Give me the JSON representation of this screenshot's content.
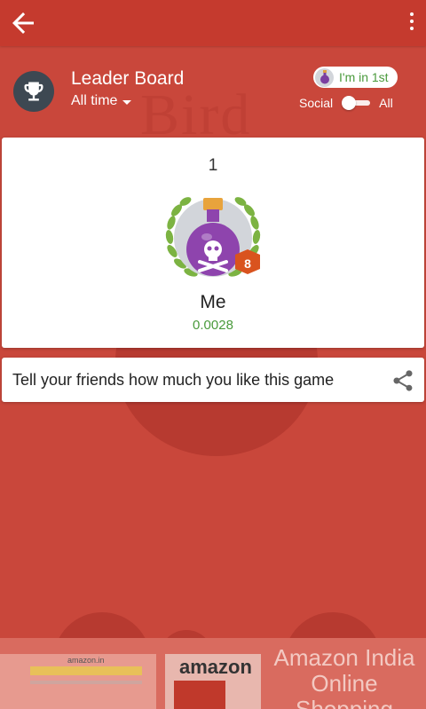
{
  "header": {
    "title": "Leader Board",
    "time_filter": "All time",
    "rank_chip": "I'm in 1st",
    "toggle_left": "Social",
    "toggle_right": "All"
  },
  "player": {
    "rank": "1",
    "badge_level": "8",
    "name": "Me",
    "score": "0.0028"
  },
  "share": {
    "text": "Tell your friends how much you like this game"
  },
  "background": {
    "word": "Bird"
  },
  "ad": {
    "logo": "amazon",
    "small_logo": "amazon.in",
    "headline": "Amazon India Online Shopping"
  },
  "colors": {
    "background": "#c9473b",
    "appbar": "#c53a2e",
    "score_green": "#4a9a3c",
    "trophy_bg": "#3d4852",
    "badge_orange": "#d9531e"
  },
  "icons": [
    "back-arrow-icon",
    "more-vert-icon",
    "trophy-icon",
    "dropdown-caret-icon",
    "share-icon"
  ]
}
